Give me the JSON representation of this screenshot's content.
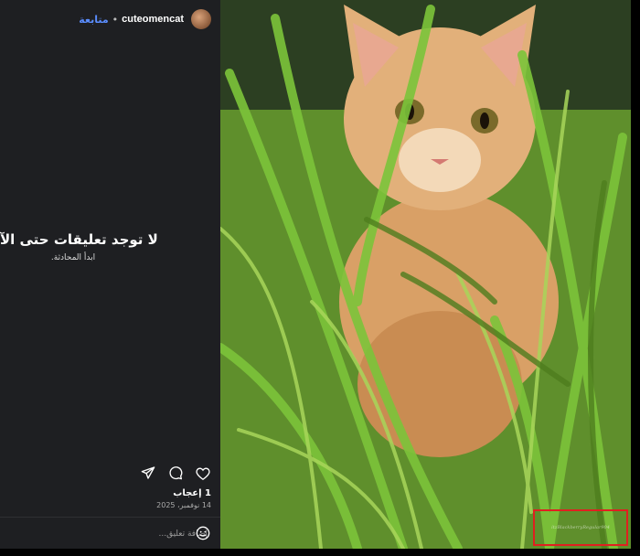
{
  "post": {
    "username": "cuteomencat",
    "separator": "•",
    "follow_label": "متابعة",
    "likes": "1 إعجاب",
    "date": "14 نوفمبر، 2025"
  },
  "comments": {
    "empty_title": "لا توجد تعليقات حتى الآن",
    "empty_subtitle": "ابدأ المحادثة."
  },
  "compose": {
    "placeholder": "إضافة تعليق..."
  },
  "photo": {
    "watermark_text": "itzBlackberryRegular904"
  },
  "icons": {
    "like": "heart-icon",
    "comment": "comment-icon",
    "share": "share-icon",
    "emoji": "emoji-icon"
  },
  "colors": {
    "panel_bg": "#1e1f22",
    "follow": "#5a8dff",
    "watermark_box": "#e02020"
  }
}
